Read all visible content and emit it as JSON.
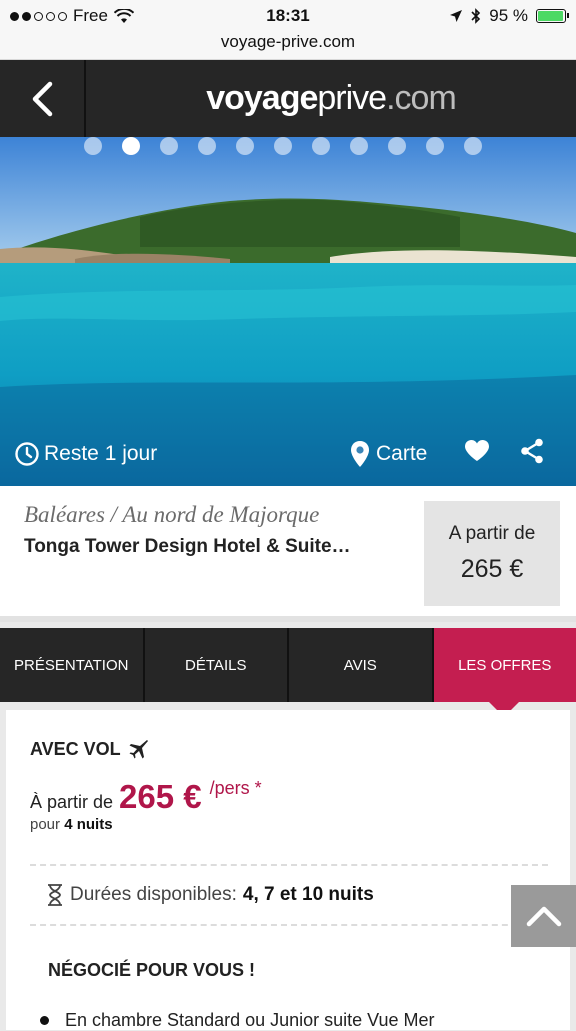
{
  "status": {
    "carrier": "Free",
    "time": "18:31",
    "battery": "95 %",
    "battery_level": 0.95
  },
  "browser": {
    "url": "voyage-prive.com"
  },
  "header": {
    "logo_a": "voyage",
    "logo_b": "prive",
    "logo_c": ".com"
  },
  "hero": {
    "slides": 11,
    "active_slide": 1,
    "remaining": "Reste 1 jour",
    "map_label": "Carte"
  },
  "offer": {
    "region": "Baléares / Au nord de Majorque",
    "hotel": "Tonga Tower Design Hotel & Suite…",
    "price_label": "A partir de",
    "price_value": "265 €"
  },
  "tabs": [
    "PRÉSENTATION",
    "DÉTAILS",
    "AVIS",
    "LES OFFRES"
  ],
  "content": {
    "avec_vol": "AVEC VOL",
    "from_label": "À partir de",
    "price": "265 €",
    "per": "/pers *",
    "for_label": "pour",
    "nights": "4 nuits",
    "durations_label": "Durées disponibles:",
    "durations_value": "4, 7 et 10 nuits",
    "negotiated": "NÉGOCIÉ POUR VOUS !",
    "bullet1": "En chambre Standard ou Junior suite Vue Mer"
  },
  "colors": {
    "accent": "#c41e50",
    "header": "#262626"
  }
}
